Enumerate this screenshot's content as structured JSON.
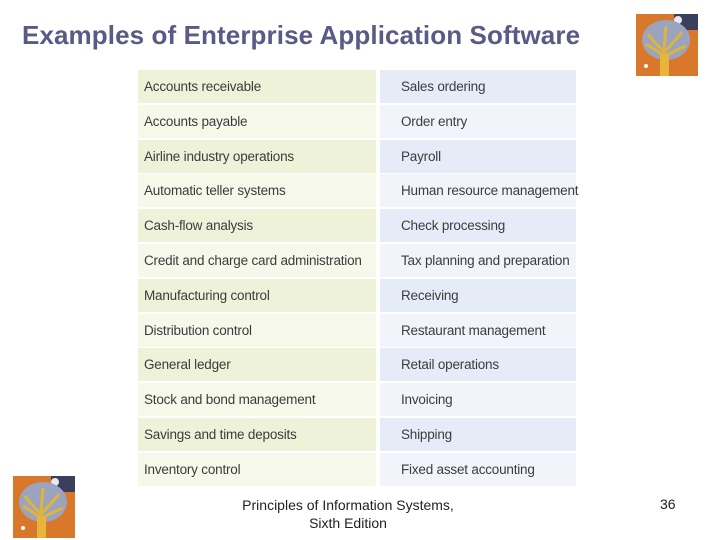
{
  "slide": {
    "title": "Examples of Enterprise Application Software",
    "logo_icon": "tree-painting-icon",
    "table": {
      "rows": [
        [
          "Accounts receivable",
          "Sales ordering"
        ],
        [
          "Accounts payable",
          "Order entry"
        ],
        [
          "Airline industry operations",
          "Payroll"
        ],
        [
          "Automatic teller systems",
          "Human resource management"
        ],
        [
          "Cash-flow analysis",
          "Check processing"
        ],
        [
          "Credit and charge card administration",
          "Tax planning and preparation"
        ],
        [
          "Manufacturing control",
          "Receiving"
        ],
        [
          "Distribution control",
          "Restaurant management"
        ],
        [
          "General ledger",
          "Retail operations"
        ],
        [
          "Stock and bond management",
          "Invoicing"
        ],
        [
          "Savings and time deposits",
          "Shipping"
        ],
        [
          "Inventory control",
          "Fixed asset accounting"
        ]
      ]
    },
    "footer": {
      "line1": "Principles of Information Systems,",
      "line2": "Sixth Edition",
      "page_number": "36"
    },
    "colors": {
      "title": "#5a5a86",
      "left_column": "#eef2d8",
      "right_column": "#e5ecf8"
    }
  }
}
